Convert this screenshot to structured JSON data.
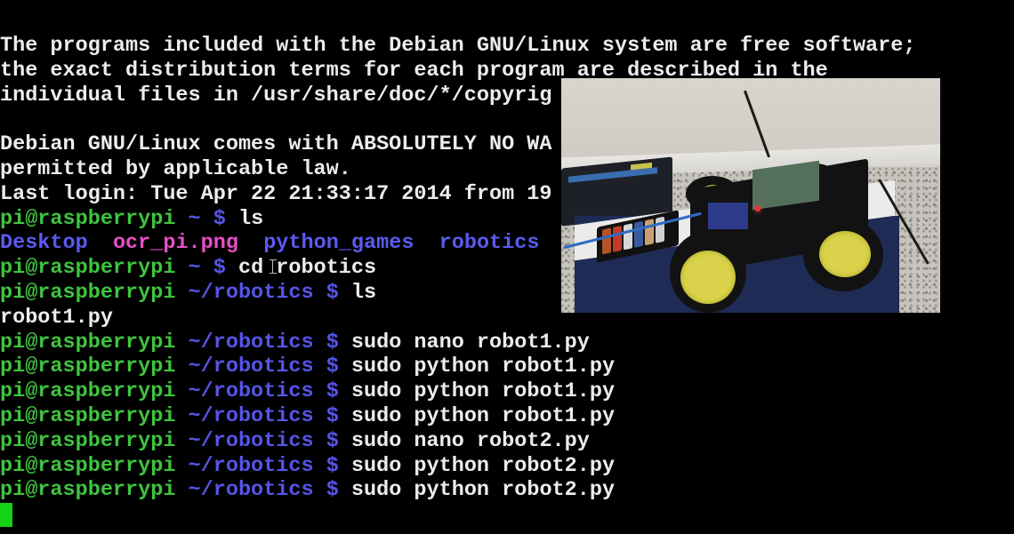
{
  "terminal": {
    "motd": [
      "The programs included with the Debian GNU/Linux system are free software;",
      "the exact distribution terms for each program are described in the",
      "individual files in /usr/share/doc/*/copyrig",
      "",
      "Debian GNU/Linux comes with ABSOLUTELY NO WA",
      "permitted by applicable law.",
      "Last login: Tue Apr 22 21:33:17 2014 from 19"
    ],
    "prompt_user": "pi@raspberrypi",
    "session": [
      {
        "path": "~",
        "command": "ls"
      },
      {
        "listing": [
          {
            "name": "Desktop",
            "type": "dir"
          },
          {
            "name": "ocr_pi.png",
            "type": "image"
          },
          {
            "name": "python_games",
            "type": "dir"
          },
          {
            "name": "robotics",
            "type": "dir"
          }
        ]
      },
      {
        "path": "~",
        "command": "cd robotics"
      },
      {
        "path": "~/robotics",
        "command": "ls"
      },
      {
        "output": "robot1.py"
      },
      {
        "path": "~/robotics",
        "command": "sudo nano robot1.py"
      },
      {
        "path": "~/robotics",
        "command": "sudo python robot1.py"
      },
      {
        "path": "~/robotics",
        "command": "sudo python robot1.py"
      },
      {
        "path": "~/robotics",
        "command": "sudo python robot1.py"
      },
      {
        "path": "~/robotics",
        "command": "sudo nano robot2.py"
      },
      {
        "path": "~/robotics",
        "command": "sudo python robot2.py"
      },
      {
        "path": "~/robotics",
        "command": "sudo python robot2.py"
      }
    ],
    "prompt_symbol": "$",
    "colors": {
      "user": "#3fc43f",
      "path": "#5555e8",
      "directory": "#5a5af0",
      "image_file": "#e84ec8",
      "text": "#ececec",
      "cursor": "#14d214",
      "background": "#000000"
    }
  },
  "overlay": {
    "description": "Video inset photo of a four-wheeled robot car with yellow wheels, Raspberry Pi board and AA battery pack on a white/navy box"
  }
}
